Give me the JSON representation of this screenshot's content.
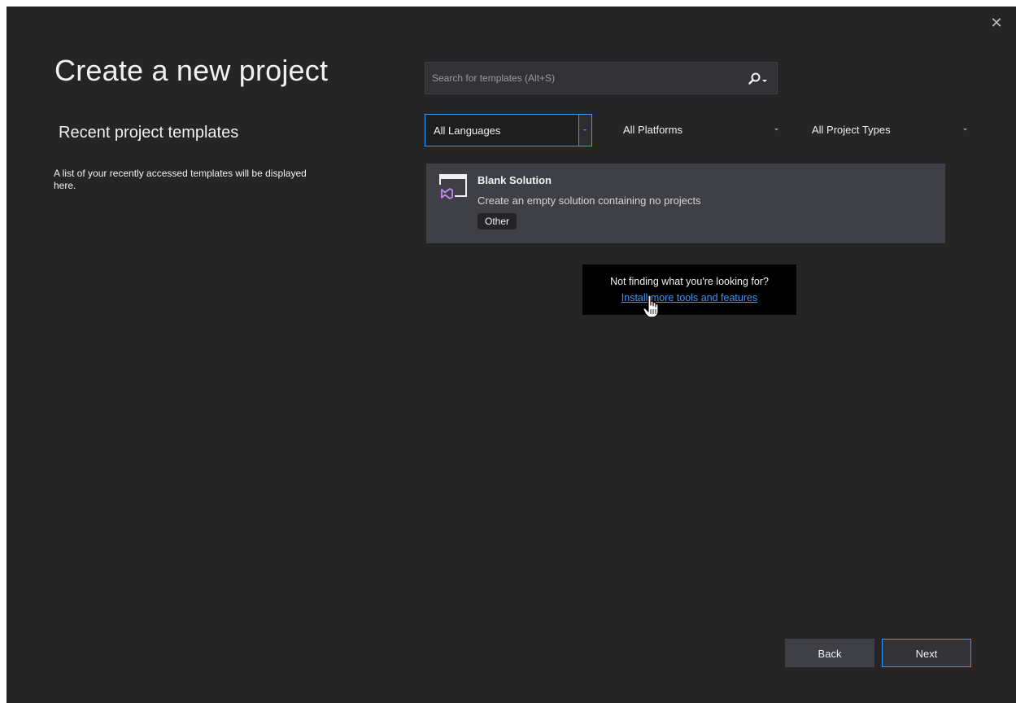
{
  "window": {
    "close_glyph": "✕"
  },
  "header": {
    "title": "Create a new project"
  },
  "recent": {
    "title": "Recent project templates",
    "description": "A list of your recently accessed templates will be displayed here."
  },
  "search": {
    "placeholder": "Search for templates (Alt+S)",
    "value": "",
    "icon": "search-icon"
  },
  "filters": {
    "language": "All Languages",
    "platform": "All Platforms",
    "project_type": "All Project Types"
  },
  "templates": [
    {
      "name": "Blank Solution",
      "description": "Create an empty solution containing no projects",
      "tag": "Other",
      "icon": "visual-studio-solution-icon"
    }
  ],
  "tooltip": {
    "text": "Not finding what you're looking for?",
    "link": "Install more tools and features"
  },
  "footer": {
    "back_label": "Back",
    "next_label": "Next"
  },
  "colors": {
    "background": "#252526",
    "accent": "#3399ff",
    "card": "#3f3f46",
    "vs_purple": "#c586f5"
  }
}
